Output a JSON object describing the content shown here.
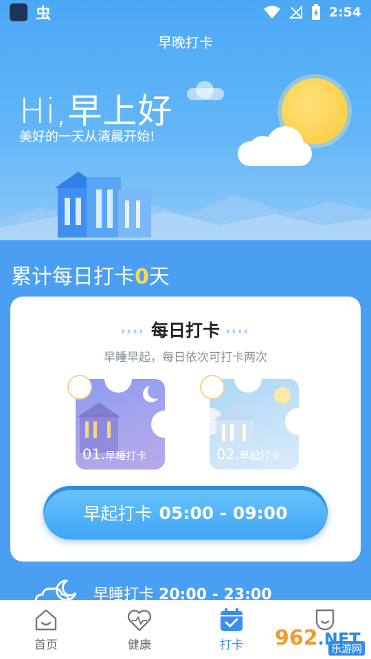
{
  "status_bar": {
    "time": "2:54",
    "icons": [
      "app-square-icon",
      "bug-icon",
      "wifi-icon",
      "no-signal-icon",
      "battery-charging-icon"
    ]
  },
  "header": {
    "title": "早晚打卡"
  },
  "hero": {
    "greeting": "Hi,早上好",
    "subtitle": "美好的一天从清晨开始!"
  },
  "counter": {
    "prefix": "累计每日打卡",
    "value": "0",
    "suffix": "天"
  },
  "card": {
    "title": "每日打卡",
    "subtitle": "早睡早起，每日依次可打卡两次",
    "pieces": [
      {
        "number": "01.",
        "label": "早睡打卡"
      },
      {
        "number": "02.",
        "label": "早起打卡"
      }
    ],
    "morning_button": {
      "label": "早起打卡",
      "time": "05:00 - 09:00"
    }
  },
  "evening": {
    "label": "早睡打卡",
    "time": "20:00 - 23:00"
  },
  "tabbar": {
    "tabs": [
      {
        "label": "首页",
        "icon": "home-icon"
      },
      {
        "label": "健康",
        "icon": "heart-pulse-icon"
      },
      {
        "label": "打卡",
        "icon": "calendar-check-icon",
        "active": true
      },
      {
        "label": "",
        "icon": "profile-icon"
      }
    ]
  },
  "watermark": {
    "brand": "962",
    "suffix": ".NET",
    "sub": "乐游网"
  },
  "colors": {
    "accent": "#3a8ef0",
    "count_highlight": "#ffd84d",
    "background": "#4a9ff3"
  }
}
